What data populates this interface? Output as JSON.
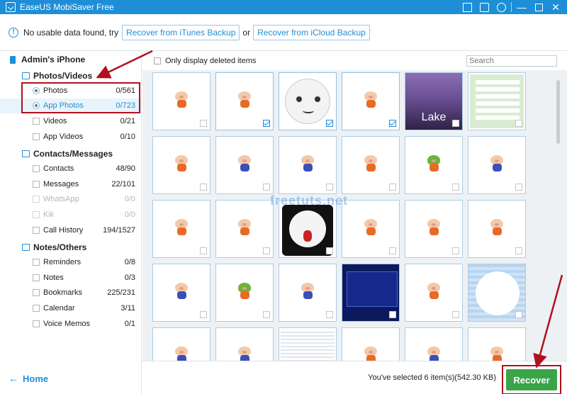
{
  "window": {
    "title": "EaseUS MobiSaver Free",
    "icons": [
      "upload-icon",
      "account-icon",
      "globe-icon",
      "minimize-icon",
      "maximize-icon",
      "close-icon"
    ]
  },
  "notice": {
    "message": "No usable data found, try",
    "itunes_button": "Recover from iTunes Backup",
    "or": "or",
    "icloud_button": "Recover from iCloud Backup"
  },
  "sidebar": {
    "device": "Admin's iPhone",
    "groups": [
      {
        "title": "Photos/Videos",
        "items": [
          {
            "label": "Photos",
            "count": "0/561",
            "type": "radio"
          },
          {
            "label": "App Photos",
            "count": "0/723",
            "type": "radio",
            "active": true
          },
          {
            "label": "Videos",
            "count": "0/21",
            "type": "checkbox"
          },
          {
            "label": "App Videos",
            "count": "0/10",
            "type": "checkbox"
          }
        ]
      },
      {
        "title": "Contacts/Messages",
        "items": [
          {
            "label": "Contacts",
            "count": "48/90",
            "type": "checkbox"
          },
          {
            "label": "Messages",
            "count": "22/101",
            "type": "checkbox"
          },
          {
            "label": "WhatsApp",
            "count": "0/0",
            "type": "checkbox",
            "disabled": true
          },
          {
            "label": "Kik",
            "count": "0/0",
            "type": "checkbox",
            "disabled": true
          },
          {
            "label": "Call History",
            "count": "194/1527",
            "type": "checkbox"
          }
        ]
      },
      {
        "title": "Notes/Others",
        "items": [
          {
            "label": "Reminders",
            "count": "0/8",
            "type": "checkbox"
          },
          {
            "label": "Notes",
            "count": "0/3",
            "type": "checkbox"
          },
          {
            "label": "Bookmarks",
            "count": "225/231",
            "type": "checkbox"
          },
          {
            "label": "Calendar",
            "count": "3/11",
            "type": "checkbox"
          },
          {
            "label": "Voice Memos",
            "count": "0/1",
            "type": "checkbox"
          }
        ]
      }
    ],
    "home_label": "Home"
  },
  "content": {
    "only_deleted_label": "Only display deleted items",
    "search_placeholder": "Search",
    "lake_label": "Lake",
    "watermark": "freetuts.net",
    "thumbnails": [
      {
        "kind": "pig",
        "checked": false
      },
      {
        "kind": "pig",
        "checked": true
      },
      {
        "kind": "cat",
        "checked": true
      },
      {
        "kind": "pig",
        "checked": true
      },
      {
        "kind": "lake",
        "checked": false
      },
      {
        "kind": "chat",
        "checked": false
      },
      {
        "kind": "pig",
        "checked": false
      },
      {
        "kind": "pig-blue",
        "checked": false
      },
      {
        "kind": "pig-blue",
        "checked": false
      },
      {
        "kind": "pig",
        "checked": false
      },
      {
        "kind": "pig-green",
        "checked": false
      },
      {
        "kind": "pig-blue",
        "checked": false
      },
      {
        "kind": "pig",
        "checked": false
      },
      {
        "kind": "pig",
        "checked": false
      },
      {
        "kind": "scary-cat",
        "checked": false
      },
      {
        "kind": "pig",
        "checked": false
      },
      {
        "kind": "pig",
        "checked": false
      },
      {
        "kind": "pig",
        "checked": false
      },
      {
        "kind": "pig-blue",
        "checked": false
      },
      {
        "kind": "pig-green",
        "checked": false
      },
      {
        "kind": "pig-blue",
        "checked": false
      },
      {
        "kind": "screen",
        "checked": false
      },
      {
        "kind": "pig",
        "checked": false
      },
      {
        "kind": "sad-cat",
        "checked": false
      },
      {
        "kind": "pig-blue",
        "checked": false
      },
      {
        "kind": "pig-blue",
        "checked": false
      },
      {
        "kind": "doc",
        "checked": false
      },
      {
        "kind": "pig",
        "checked": false
      },
      {
        "kind": "pig-blue",
        "checked": false
      },
      {
        "kind": "pig",
        "checked": false
      }
    ]
  },
  "footer": {
    "status": "You've selected 6 item(s)(542.30 KB)",
    "recover_button": "Recover"
  },
  "colors": {
    "accent": "#1e8fd6",
    "recover": "#3aa548",
    "annotation": "#b2101f"
  }
}
